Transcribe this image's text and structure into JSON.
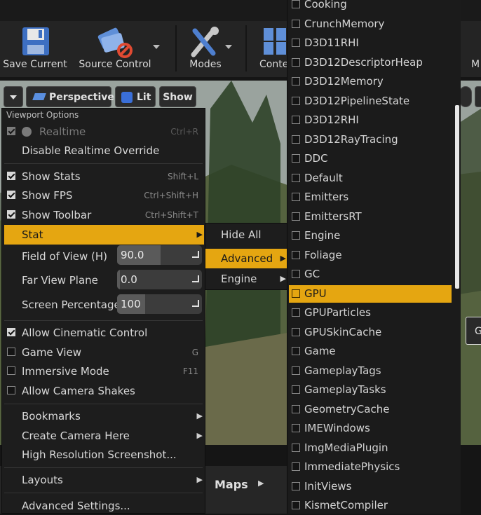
{
  "toolbar": {
    "save": "Save Current",
    "source_control": "Source Control",
    "modes": "Modes",
    "content": "Conte",
    "right_partial": "M"
  },
  "viewport_bar": {
    "perspective": "Perspective",
    "lit": "Lit",
    "show": "Show",
    "right_partial": "G"
  },
  "menu": {
    "header": "Viewport Options",
    "realtime": {
      "label": "Realtime",
      "shortcut": "Ctrl+R",
      "checked": true
    },
    "disable_realtime": "Disable Realtime Override",
    "show_stats": {
      "label": "Show Stats",
      "shortcut": "Shift+L",
      "checked": true
    },
    "show_fps": {
      "label": "Show FPS",
      "shortcut": "Ctrl+Shift+H",
      "checked": true
    },
    "show_toolbar": {
      "label": "Show Toolbar",
      "shortcut": "Ctrl+Shift+T",
      "checked": true
    },
    "stat": "Stat",
    "fov": {
      "label": "Field of View (H)",
      "value": "90.0"
    },
    "far_view": {
      "label": "Far View Plane",
      "value": "0.0"
    },
    "screen_pct": {
      "label": "Screen Percentage",
      "value": "100"
    },
    "cinematic": {
      "label": "Allow Cinematic Control",
      "checked": true
    },
    "game_view": {
      "label": "Game View",
      "shortcut": "G",
      "checked": false
    },
    "immersive": {
      "label": "Immersive Mode",
      "shortcut": "F11",
      "checked": false
    },
    "camera_shakes": {
      "label": "Allow Camera Shakes",
      "checked": false
    },
    "bookmarks": "Bookmarks",
    "create_camera": "Create Camera Here",
    "hires_screenshot": "High Resolution Screenshot...",
    "layouts": "Layouts",
    "advanced_settings": "Advanced Settings..."
  },
  "submenu": {
    "hide_all": "Hide All",
    "advanced": "Advanced",
    "engine": "Engine"
  },
  "stat_list": [
    "Cooking",
    "CrunchMemory",
    "D3D11RHI",
    "D3D12DescriptorHeap",
    "D3D12Memory",
    "D3D12PipelineState",
    "D3D12RHI",
    "D3D12RayTracing",
    "DDC",
    "Default",
    "Emitters",
    "EmittersRT",
    "Engine",
    "Foliage",
    "GC",
    "GPU",
    "GPUParticles",
    "GPUSkinCache",
    "Game",
    "GameplayTags",
    "GameplayTasks",
    "GeometryCache",
    "IMEWindows",
    "ImgMediaPlugin",
    "ImmediatePhysics",
    "InitViews",
    "KismetCompiler"
  ],
  "stat_list_highlight": "GPU",
  "bottom": {
    "maps": "Maps"
  },
  "colors": {
    "accent": "#e5a611",
    "menu_bg": "#1d1d1d"
  }
}
